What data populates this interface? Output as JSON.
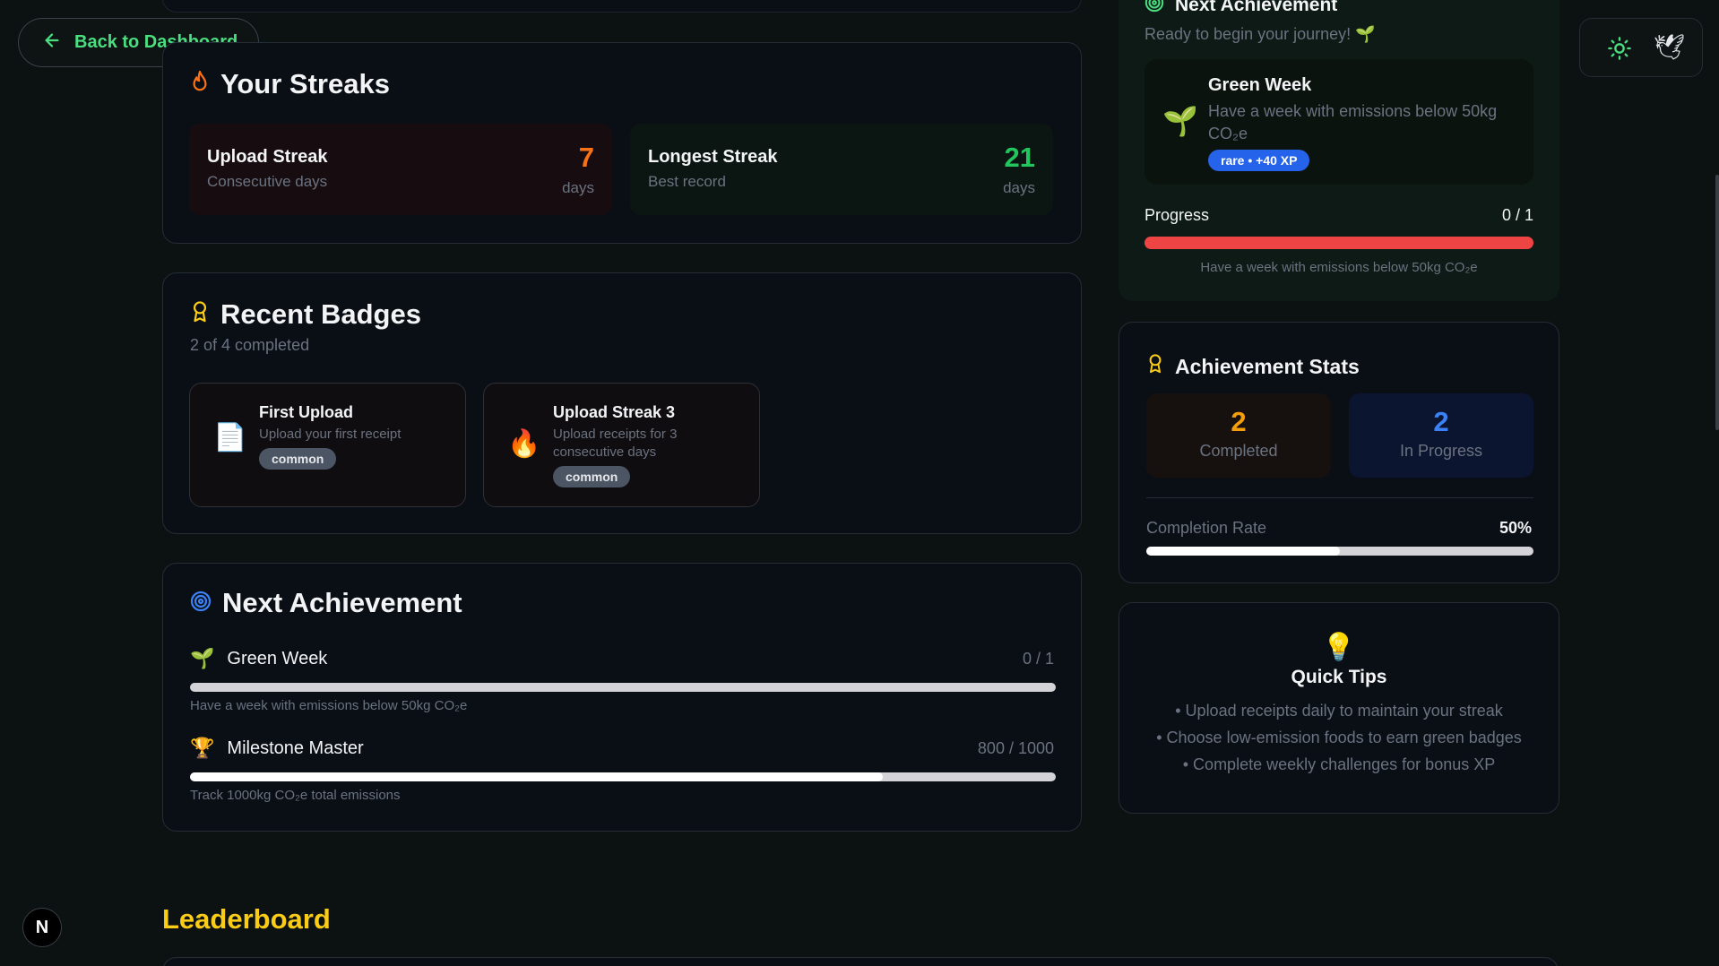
{
  "nav": {
    "back_label": "Back to Dashboard"
  },
  "streaks": {
    "title": "Your Streaks",
    "upload": {
      "label": "Upload Streak",
      "sub": "Consecutive days",
      "value": "7",
      "unit": "days"
    },
    "longest": {
      "label": "Longest Streak",
      "sub": "Best record",
      "value": "21",
      "unit": "days"
    }
  },
  "badges": {
    "title": "Recent Badges",
    "subtitle": "2 of 4 completed",
    "items": [
      {
        "title": "First Upload",
        "desc": "Upload your first receipt",
        "rarity": "common",
        "icon": "document-icon"
      },
      {
        "title": "Upload Streak 3",
        "desc": "Upload receipts for 3 consecutive days",
        "rarity": "common",
        "icon": "fire-icon"
      }
    ]
  },
  "next_achievement": {
    "title": "Next Achievement",
    "items": [
      {
        "icon": "seedling-icon",
        "title": "Green Week",
        "count": "0 / 1",
        "progress": 0,
        "desc": "Have a week with emissions below 50kg CO₂e"
      },
      {
        "icon": "trophy-icon",
        "title": "Milestone Master",
        "count": "800 / 1000",
        "progress": 0.8,
        "desc": "Track 1000kg CO₂e total emissions"
      }
    ]
  },
  "side_next": {
    "title": "Next Achievement",
    "tagline": "Ready to begin your journey! 🌱",
    "card_title": "Green Week",
    "card_desc": "Have a week with emissions below 50kg CO₂e",
    "pill": "rare • +40 XP",
    "progress_label": "Progress",
    "progress_count": "0 / 1",
    "progress_value": 0,
    "footnote": "Have a week with emissions below 50kg CO₂e"
  },
  "stats": {
    "title": "Achievement Stats",
    "completed_value": "2",
    "completed_label": "Completed",
    "in_progress_value": "2",
    "in_progress_label": "In Progress",
    "rate_label": "Completion Rate",
    "rate_value": "50%",
    "rate_progress": 0.5
  },
  "tips": {
    "title": "Quick Tips",
    "lines": [
      "• Upload receipts daily to maintain your streak",
      "• Choose low-emission foods to earn green badges",
      "• Complete weekly challenges for bonus XP"
    ]
  },
  "leaderboard": {
    "title": "Leaderboard"
  },
  "dev": {
    "badge": "N"
  },
  "colors": {
    "accent": "#4ade80",
    "orange": "#f97316",
    "green": "#22c55e",
    "blue": "#3b82f6",
    "yellow": "#facc15",
    "red": "#ef4444"
  }
}
